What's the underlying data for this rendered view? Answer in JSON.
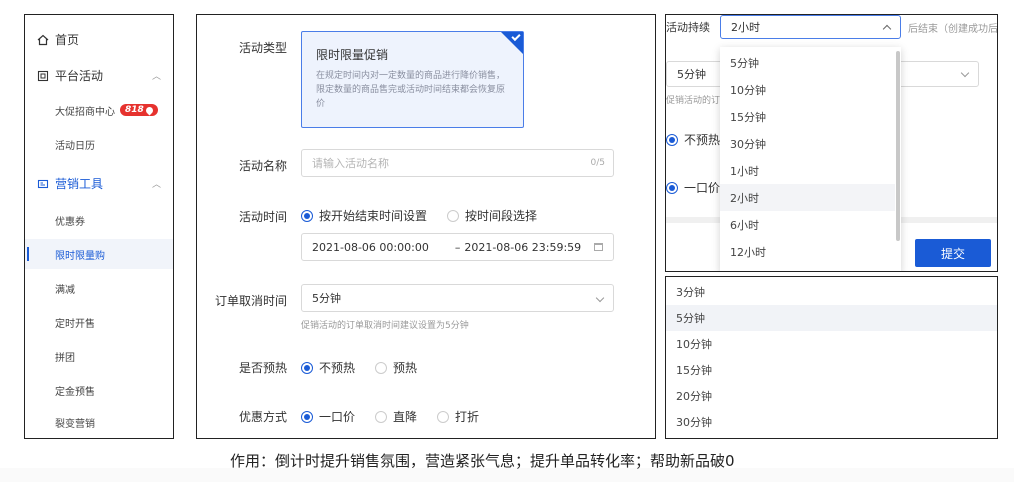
{
  "sidebar": {
    "home": "首页",
    "platform": "平台活动",
    "platform_items": [
      "大促招商中心",
      "活动日历"
    ],
    "badge": "818",
    "marketing": "营销工具",
    "marketing_items": [
      "优惠券",
      "限时限量购",
      "满减",
      "定时开售",
      "拼团",
      "定金预售",
      "裂变营销"
    ],
    "active_item": "限时限量购",
    "colors": {
      "accent": "#1a5bd6",
      "badge": "#e6322e"
    }
  },
  "form": {
    "type_label": "活动类型",
    "type_card_title": "限时限量促销",
    "type_card_desc": "在规定时间内对一定数量的商品进行降价销售，限定数量的商品售完或活动时间结束都会恢复原价",
    "name_label": "活动名称",
    "name_placeholder": "请输入活动名称",
    "name_counter": "0/5",
    "time_label": "活动时间",
    "time_opt1": "按开始结束时间设置",
    "time_opt2": "按时间段选择",
    "time_start": "2021-08-06 00:00:00",
    "time_sep": "–",
    "time_end": "2021-08-06 23:59:59",
    "cancel_label": "订单取消时间",
    "cancel_value": "5分钟",
    "cancel_hint": "促销活动的订单取消时间建议设置为5分钟",
    "preheat_label": "是否预热",
    "preheat_opt1": "不预热",
    "preheat_opt2": "预热",
    "discount_label": "优惠方式",
    "discount_opt1": "一口价",
    "discount_opt2": "直降",
    "discount_opt3": "打折"
  },
  "dropdown": {
    "label": "活动持续",
    "selected": "2小时",
    "after_text": "后结束（创建成功后",
    "bg_select_value": "5分钟",
    "bg_hint": "促销活动的订",
    "bg_radio1": "不预热",
    "bg_radio2": "一口价",
    "submit": "提交",
    "options": [
      "5分钟",
      "10分钟",
      "15分钟",
      "30分钟",
      "1小时",
      "2小时",
      "6小时",
      "12小时"
    ],
    "highlighted": "2小时"
  },
  "list": {
    "options": [
      "3分钟",
      "5分钟",
      "10分钟",
      "15分钟",
      "20分钟",
      "30分钟"
    ],
    "highlighted": "5分钟"
  },
  "caption": "作用：倒计时提升销售氛围，营造紧张气息；提升单品转化率；帮助新品破0"
}
